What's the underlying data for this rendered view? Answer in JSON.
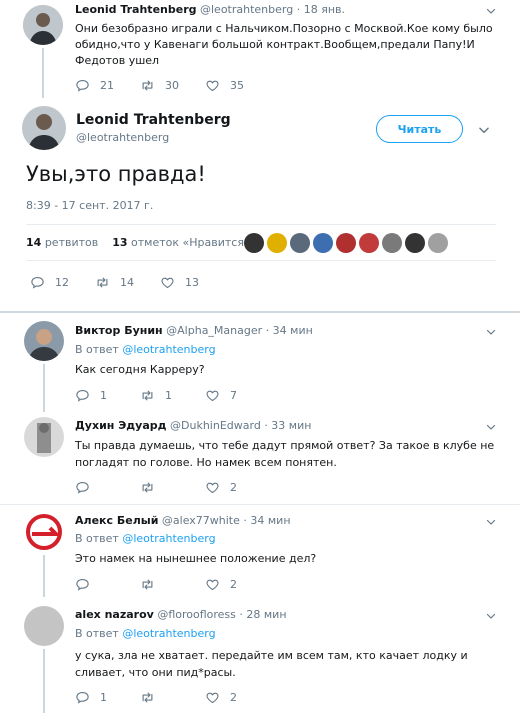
{
  "prev_tweet": {
    "name": "Leonid Trahtenberg",
    "handle": "@leotrahtenberg",
    "date": "· 18 янв.",
    "text": "Они безобразно играли с Нальчиком.Позорно с Москвой.Кое кому было обидно,что у Кавенаги большой контракт.Вообщем,предали Папу!И Федотов ушел",
    "replies": "21",
    "retweets": "30",
    "likes": "35"
  },
  "main_tweet": {
    "name": "Leonid Trahtenberg",
    "handle": "@leotrahtenberg",
    "follow_label": "Читать",
    "text": "Увы,это правда!",
    "timestamp": "8:39 - 17 сент. 2017 г.",
    "retweet_count": "14",
    "retweet_label": "ретвитов",
    "like_count": "13",
    "like_label": "отметок «Нравится»",
    "replies": "12",
    "retweets": "14",
    "likes": "13"
  },
  "replies": [
    {
      "name": "Виктор Бунин",
      "handle": "@Alpha_Manager",
      "time": "· 34 мин",
      "reply_to_prefix": "В ответ",
      "reply_to": "@leotrahtenberg",
      "text": "Как сегодня Карреру?",
      "replies": "1",
      "retweets": "1",
      "likes": "7"
    },
    {
      "name": "Духин Эдуард",
      "handle": "@DukhinEdward",
      "time": "· 33 мин",
      "text": "Ты правда думаешь, что тебе дадут прямой ответ? За такое в клубе не погладят по голове. Но намек всем понятен.",
      "replies": "",
      "retweets": "",
      "likes": "2"
    },
    {
      "name": "Алекс Белый",
      "handle": "@alex77white",
      "time": "· 34 мин",
      "reply_to_prefix": "В ответ",
      "reply_to": "@leotrahtenberg",
      "text": "Это намек на нынешнее положение дел?",
      "replies": "",
      "retweets": "",
      "likes": "2"
    },
    {
      "name": "alex nazarov",
      "handle": "@floroofloress",
      "time": "· 28 мин",
      "reply_to_prefix": "В ответ",
      "reply_to": "@leotrahtenberg",
      "text": "у сука, зла не хватает. передайте им всем там, кто качает лодку и сливает, что они пид*расы.",
      "replies": "1",
      "retweets": "",
      "likes": "2"
    }
  ],
  "icons": {
    "reply": "reply-icon",
    "retweet": "retweet-icon",
    "like": "heart-icon",
    "caret": "chevron-down-icon"
  },
  "colors": {
    "accent": "#1da1f2",
    "muted": "#657786",
    "divider": "#e6ecf0"
  }
}
